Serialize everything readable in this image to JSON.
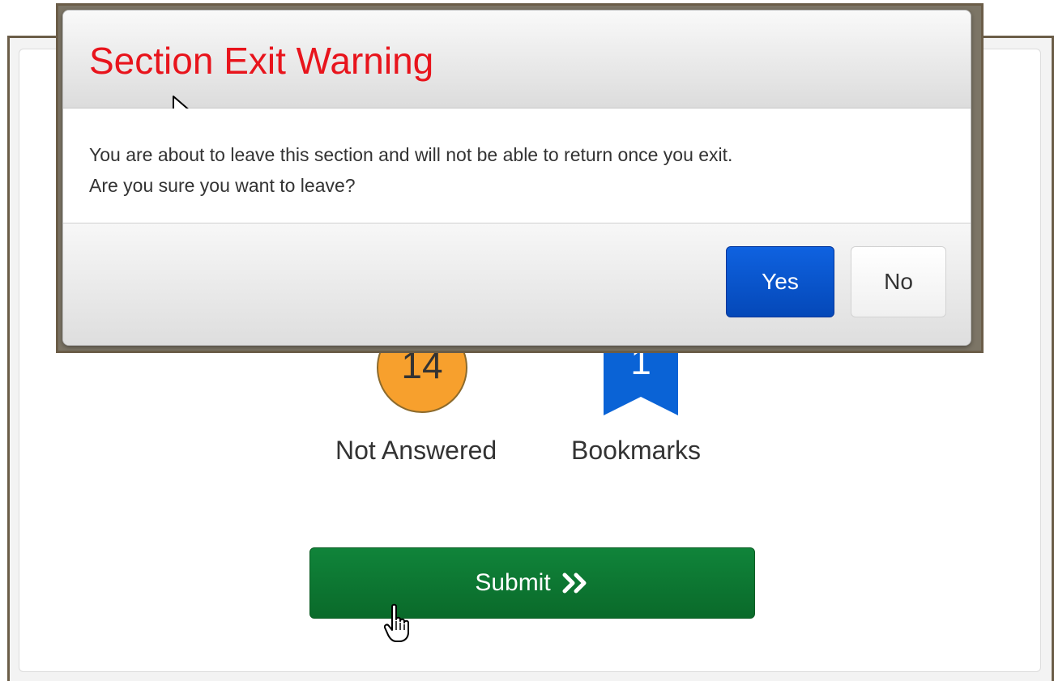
{
  "modal": {
    "title": "Section Exit Warning",
    "message_line1": "You are about to leave this section and will not be able to return once you exit.",
    "message_line2": "Are you sure you want to leave?",
    "yes_label": "Yes",
    "no_label": "No"
  },
  "summary": {
    "not_answered_count": "14",
    "not_answered_label": "Not Answered",
    "bookmarks_count": "1",
    "bookmarks_label": "Bookmarks"
  },
  "submit": {
    "label": "Submit",
    "icon": "double-chevron-right-icon"
  },
  "colors": {
    "title_red": "#e8141c",
    "yes_blue": "#0a55cc",
    "submit_green": "#0b7030",
    "not_answered_orange": "#f7a02d",
    "bookmark_blue": "#0a63d6"
  }
}
